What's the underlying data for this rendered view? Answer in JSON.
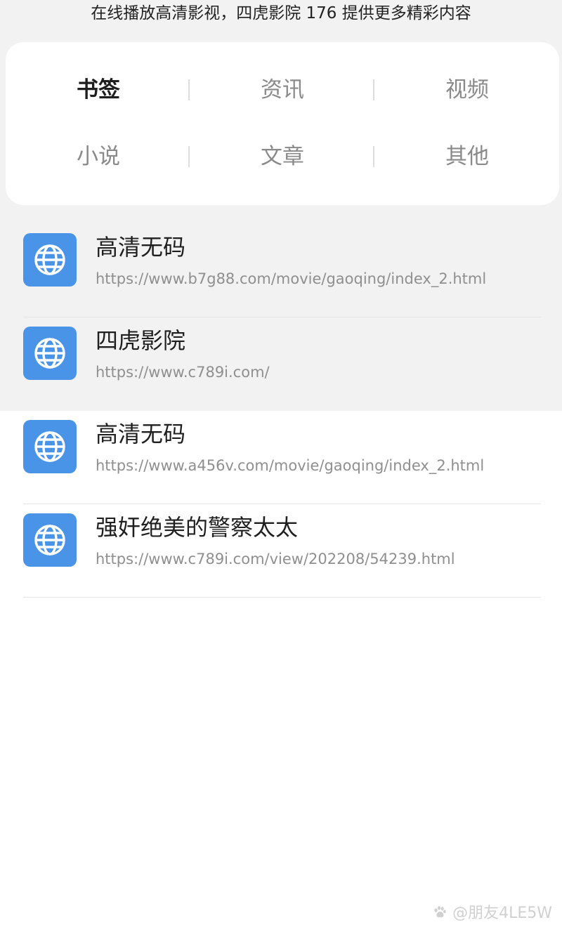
{
  "header": {
    "caption": "在线播放高清影视，四虎影院 176 提供更多精彩内容"
  },
  "categories": [
    {
      "label": "书签",
      "active": true
    },
    {
      "label": "资讯",
      "active": false
    },
    {
      "label": "视频",
      "active": false
    },
    {
      "label": "小说",
      "active": false
    },
    {
      "label": "文章",
      "active": false
    },
    {
      "label": "其他",
      "active": false
    }
  ],
  "bookmarks": [
    {
      "title": "高清无码",
      "url": "https://www.b7g88.com/movie/gaoqing/index_2.html",
      "icon": "globe-icon"
    },
    {
      "title": "四虎影院",
      "url": "https://www.c789i.com/",
      "icon": "globe-icon"
    },
    {
      "title": "高清无码",
      "url": "https://www.a456v.com/movie/gaoqing/index_2.html",
      "icon": "globe-icon"
    },
    {
      "title": "强奸绝美的警察太太",
      "url": "https://www.c789i.com/view/202208/54239.html",
      "icon": "globe-icon"
    }
  ],
  "watermark": {
    "text": "@朋友4LE5W",
    "icon": "paw-icon"
  },
  "colors": {
    "icon_tile": "#4a94e8",
    "background_gray": "#f2f2f3",
    "card": "#ffffff"
  }
}
